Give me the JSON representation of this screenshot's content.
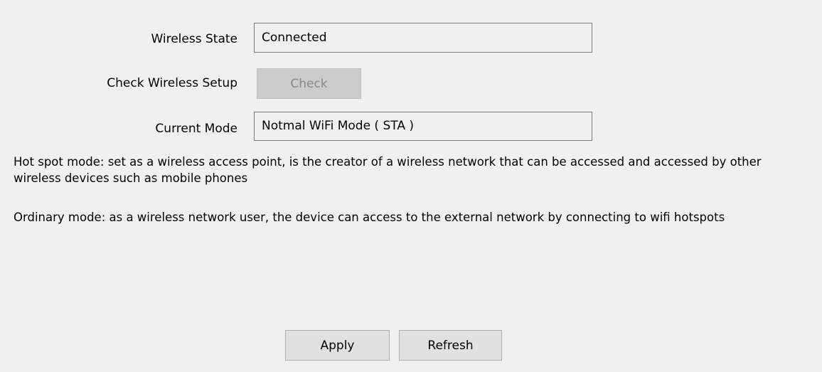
{
  "wireless_state": {
    "label": "Wireless State",
    "value": "Connected"
  },
  "check_setup": {
    "label": "Check Wireless Setup",
    "button_label": "Check",
    "button_enabled": false
  },
  "current_mode": {
    "label": "Current Mode",
    "value": "Notmal WiFi Mode ( STA )"
  },
  "descriptions": {
    "hotspot": "Hot spot mode: set as a wireless access point, is the creator of a wireless network that can be accessed and accessed by other wireless devices such as mobile phones",
    "ordinary": "Ordinary mode: as a wireless network user, the device can access to the external network by connecting to wifi hotspots"
  },
  "actions": {
    "apply_label": "Apply",
    "refresh_label": "Refresh"
  }
}
